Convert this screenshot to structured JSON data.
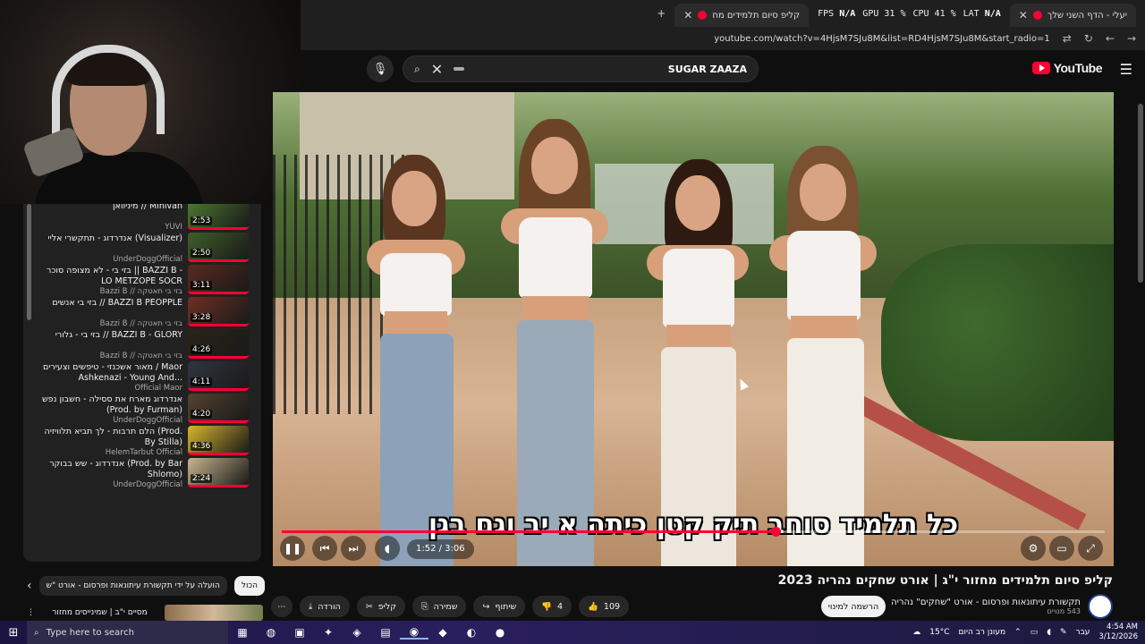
{
  "browser": {
    "tabs": [
      {
        "label": "קליפ סיום תלמידים מח"
      },
      {
        "label": "יעלי - הדף השני שלך"
      }
    ],
    "hud": {
      "fps_label": "FPS",
      "fps": "N/A",
      "gpu": "GPU 31 %",
      "cpu": "CPU 41 %",
      "lat_label": "LAT",
      "lat": "N/A"
    },
    "url": "youtube.com/watch?v=4HjsM7SJu8M&list=RD4HjsM7SJu8M&start_radio=1"
  },
  "youtube": {
    "search_query": "SUGAR ZAAZA",
    "logo_text": "YouTube"
  },
  "playlist": {
    "items": [
      {
        "title": "מיניוואן // Minivan",
        "channel": "YUVI",
        "duration": "2:53"
      },
      {
        "title": "אנדרדוג - תתקשרי אליי (Visualizer)",
        "channel": "UnderDoggOfficial",
        "duration": "2:50"
      },
      {
        "title": "בזי בי - לא מצופה סוכר || BAZZI B - LO METZOPE SOCR",
        "channel": "Bazzi B // בזי בי תאטקה",
        "duration": "3:11"
      },
      {
        "title": "בזי בי אנשים // BAZZI B PEOPPLE",
        "channel": "Bazzi B // בזי בי תאטקה",
        "duration": "3:28"
      },
      {
        "title": "בזי בי - גלורי // BAZZI B - GLORY",
        "channel": "Bazzi B // בזי בי תאטקה",
        "duration": "4:26"
      },
      {
        "title": "מאור אשכנזי - טיפשים וצעירים / Maor Ashkenazi - Young And...",
        "channel": "Official Maor",
        "duration": "4:11"
      },
      {
        "title": "אנדרדוג מארח את ססילה - חשבון נפש (Prod. by Furman)",
        "channel": "UnderDoggOfficial",
        "duration": "4:20"
      },
      {
        "title": "הלם תרבות - לך תביא תלוויזיה (Prod. By Stilla)",
        "channel": "HelemTarbut Official",
        "duration": "4:36"
      },
      {
        "title": "אנדרדוג - שש בבוקר (Prod. by Bar Shlomo)",
        "channel": "UnderDoggOfficial",
        "duration": "2:24"
      }
    ],
    "chips": [
      "הכול",
      "הועלה על ידי תקשורת עיתונאות ופרסום - אורט \"ש"
    ],
    "reco_title": "מסיים י\"ב | שמינייסים מחזור"
  },
  "player": {
    "subtitle": "כל תלמיד סוחב תיק קטן כיתה א יב וגם בגן",
    "time": "1:52 / 3:06",
    "progress_fraction": 0.6
  },
  "video": {
    "title": "קליפ סיום תלמידים מחזור י\"ג | אורט שחקים נהריה 2023",
    "channel": "תקשורת עיתונאות ופרסום - אורט \"שחקים\" נהריה",
    "subscribers": "543 מנויים",
    "subscribe_label": "הרשמה למינוי",
    "likes": "109",
    "dislikes": "4",
    "share_label": "שיתוף",
    "save_label": "שמירה",
    "clip_label": "קליפ",
    "download_label": "הורדה"
  },
  "taskbar": {
    "search_placeholder": "Type here to search",
    "weather": "15°C",
    "weather_desc": "מעונן רב היום",
    "lang": "עבר",
    "time": "4:54 AM",
    "date": "3/12/2026"
  },
  "colors": {
    "accent": "#ff0033",
    "bg": "#0f0f0f",
    "taskbar": "#2a1f5e"
  }
}
